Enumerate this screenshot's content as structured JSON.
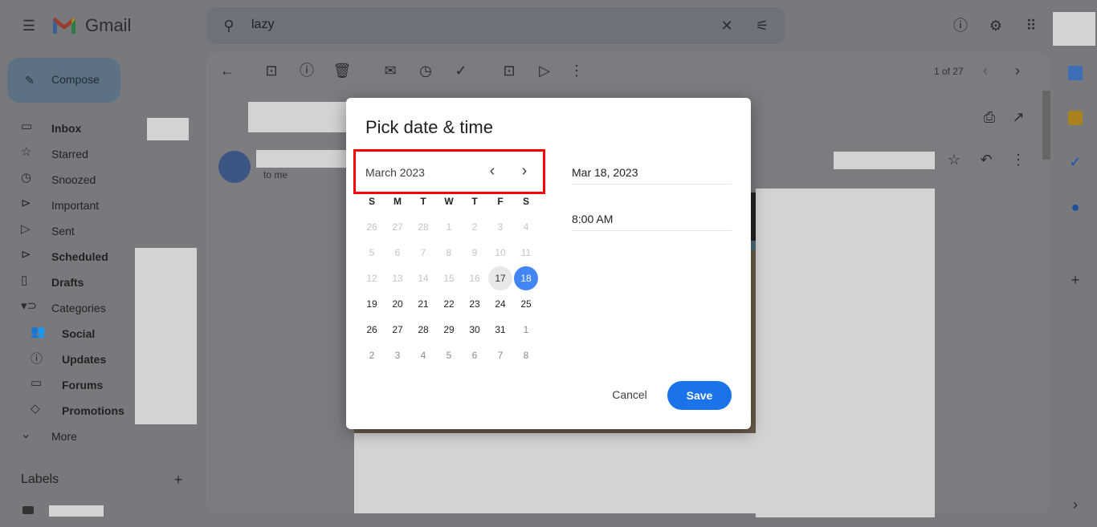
{
  "app": {
    "name": "Gmail",
    "search_query": "lazy"
  },
  "sidebar": {
    "compose": "Compose",
    "items": [
      {
        "label": "Inbox",
        "icon": "inbox-icon",
        "glyph": "▭",
        "bold": true,
        "sub": false
      },
      {
        "label": "Starred",
        "icon": "star-icon",
        "glyph": "☆",
        "bold": false,
        "sub": false
      },
      {
        "label": "Snoozed",
        "icon": "clock-icon",
        "glyph": "◷",
        "bold": false,
        "sub": false
      },
      {
        "label": "Important",
        "icon": "important-icon",
        "glyph": "⊳",
        "bold": false,
        "sub": false
      },
      {
        "label": "Sent",
        "icon": "send-icon",
        "glyph": "▷",
        "bold": false,
        "sub": false
      },
      {
        "label": "Scheduled",
        "icon": "scheduled-icon",
        "glyph": "⊳",
        "bold": true,
        "sub": false
      },
      {
        "label": "Drafts",
        "icon": "draft-icon",
        "glyph": "▯",
        "bold": true,
        "sub": false
      },
      {
        "label": "Categories",
        "icon": "label-icon",
        "glyph": "▾⊃",
        "bold": false,
        "sub": false
      },
      {
        "label": "Social",
        "icon": "people-icon",
        "glyph": "👥",
        "bold": true,
        "sub": true
      },
      {
        "label": "Updates",
        "icon": "info-icon",
        "glyph": "ⓘ",
        "bold": true,
        "sub": true
      },
      {
        "label": "Forums",
        "icon": "forum-icon",
        "glyph": "▭",
        "bold": true,
        "sub": true
      },
      {
        "label": "Promotions",
        "icon": "tag-icon",
        "glyph": "◇",
        "bold": true,
        "sub": true
      },
      {
        "label": "More",
        "icon": "chevron-down-icon",
        "glyph": "⌄",
        "bold": false,
        "sub": false
      }
    ],
    "labels_heading": "Labels"
  },
  "toolbar": {
    "pagination": "1 of 27"
  },
  "email": {
    "recipient": "to me"
  },
  "dialog": {
    "title": "Pick date & time",
    "month": "March 2023",
    "weekdays": [
      "S",
      "M",
      "T",
      "W",
      "T",
      "F",
      "S"
    ],
    "weeks": [
      [
        [
          "26",
          "prev"
        ],
        [
          "27",
          "prev"
        ],
        [
          "28",
          "prev"
        ],
        [
          "1",
          "past"
        ],
        [
          "2",
          "past"
        ],
        [
          "3",
          "past"
        ],
        [
          "4",
          "past"
        ]
      ],
      [
        [
          "5",
          "past"
        ],
        [
          "6",
          "past"
        ],
        [
          "7",
          "past"
        ],
        [
          "8",
          "past"
        ],
        [
          "9",
          "past"
        ],
        [
          "10",
          "past"
        ],
        [
          "11",
          "past"
        ]
      ],
      [
        [
          "12",
          "past"
        ],
        [
          "13",
          "past"
        ],
        [
          "14",
          "past"
        ],
        [
          "15",
          "past"
        ],
        [
          "16",
          "past"
        ],
        [
          "17",
          "today"
        ],
        [
          "18",
          "selected"
        ]
      ],
      [
        [
          "19",
          "current"
        ],
        [
          "20",
          "current"
        ],
        [
          "21",
          "current"
        ],
        [
          "22",
          "current"
        ],
        [
          "23",
          "current"
        ],
        [
          "24",
          "current"
        ],
        [
          "25",
          "current"
        ]
      ],
      [
        [
          "26",
          "current"
        ],
        [
          "27",
          "current"
        ],
        [
          "28",
          "current"
        ],
        [
          "29",
          "current"
        ],
        [
          "30",
          "current"
        ],
        [
          "31",
          "current"
        ],
        [
          "1",
          "next"
        ]
      ],
      [
        [
          "2",
          "next"
        ],
        [
          "3",
          "next"
        ],
        [
          "4",
          "next"
        ],
        [
          "5",
          "next"
        ],
        [
          "6",
          "next"
        ],
        [
          "7",
          "next"
        ],
        [
          "8",
          "next"
        ]
      ]
    ],
    "date_value": "Mar 18, 2023",
    "time_value": "8:00 AM",
    "cancel": "Cancel",
    "save": "Save",
    "accent": "#1a73e8",
    "highlight_color": "#ff0000"
  }
}
